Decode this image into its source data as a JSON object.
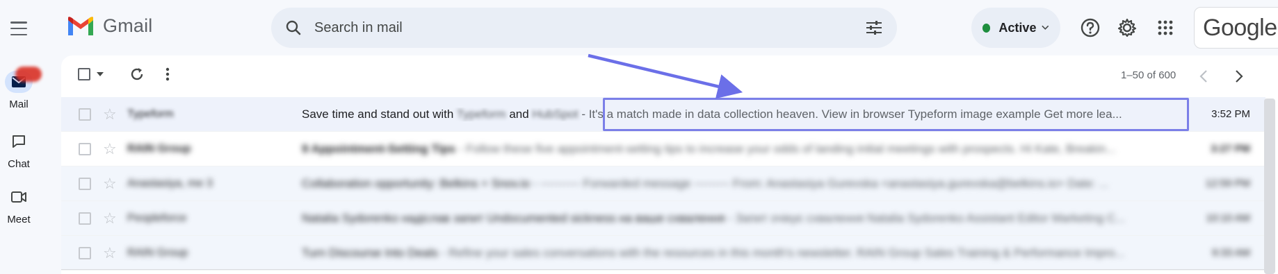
{
  "app": {
    "name": "Gmail"
  },
  "rail": {
    "items": [
      {
        "label": "Mail"
      },
      {
        "label": "Chat"
      },
      {
        "label": "Meet"
      }
    ]
  },
  "search": {
    "placeholder": "Search in mail"
  },
  "status": {
    "label": "Active",
    "color": "#1e8e3e"
  },
  "header": {
    "google_logo_text": "Google"
  },
  "toolbar": {
    "pager": "1–50 of 600"
  },
  "emails": [
    {
      "sender": "Typeform",
      "subject": "Save time and stand out with",
      "subject_brand1": "Typeform",
      "subject_and": "and",
      "subject_brand2": "HubSpot",
      "separator": " - ",
      "snippet": "It's a match made in data collection heaven. View in browser Typeform image example Get more lea...",
      "time": "3:52 PM"
    },
    {
      "sender": "RAIN Group",
      "subject": "9 Appointment-Setting Tips",
      "snippet": " - Follow these five appointment-setting tips to increase your odds of landing initial meetings with prospects. Hi Kate, Breakin...",
      "time": "3:27 PM"
    },
    {
      "sender": "Anastasiya, me 3",
      "subject": "Collaboration opportunity: Belkins + Snov.io",
      "snippet": " - ---------- Forwarded message --------- From: Anastasiya Gurevska <anastasiya.gurevska@belkins.io> Date: ...",
      "time": "12:59 PM"
    },
    {
      "sender": "Peopleforce",
      "subject": "Natalia Sydorenko надіслав запит Undocumented sickness на ваше схвалення",
      "snippet": " - Запит очікує схвалення Natalia Sydorenko Assistant Editor Marketing C...",
      "time": "10:10 AM"
    },
    {
      "sender": "RAIN Group",
      "subject": "Turn Discourse Into Deals",
      "snippet": " - Refine your sales conversations with the resources in this month's newsletter. RAIN Group Sales Training & Performance Impro...",
      "time": "9:33 AM"
    }
  ],
  "colors": {
    "accent": "#0b57d0",
    "annotation": "#6b6fe8"
  }
}
